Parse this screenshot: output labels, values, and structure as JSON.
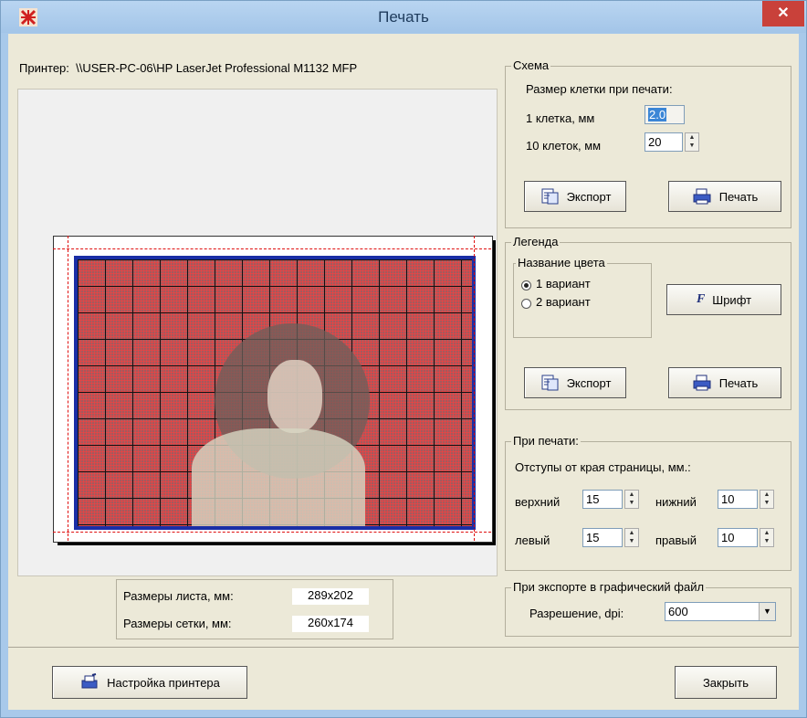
{
  "window": {
    "title": "Печать",
    "close_glyph": "✕"
  },
  "printer": {
    "label": "Принтер:",
    "name": "\\\\USER-PC-06\\HP LaserJet Professional M1132 MFP"
  },
  "schema": {
    "title": "Схема",
    "cell_size_label": "Размер клетки при печати:",
    "one_cell_label": "1 клетка, мм",
    "one_cell_value": "2.0",
    "ten_cells_label": "10 клеток, мм",
    "ten_cells_value": "20",
    "export_label": "Экспорт",
    "print_label": "Печать"
  },
  "legend": {
    "title": "Легенда",
    "color_name_title": "Название цвета",
    "variant1": "1 вариант",
    "variant2": "2 вариант",
    "selected_variant": 1,
    "font_label": "Шрифт",
    "font_icon_text": "F",
    "export_label": "Экспорт",
    "print_label": "Печать"
  },
  "print_opts": {
    "title": "При печати:",
    "margins_label": "Отступы от края страницы, мм.:",
    "top_label": "верхний",
    "top_value": "15",
    "bottom_label": "нижний",
    "bottom_value": "10",
    "left_label": "левый",
    "left_value": "15",
    "right_label": "правый",
    "right_value": "10"
  },
  "export_opts": {
    "title": "При экспорте в графический файл",
    "dpi_label": "Разрешение, dpi:",
    "dpi_value": "600"
  },
  "sizes": {
    "sheet_label": "Размеры листа, мм:",
    "sheet_value": "289x202",
    "grid_label": "Размеры сетки, мм:",
    "grid_value": "260x174"
  },
  "footer": {
    "printer_setup_label": "Настройка принтера",
    "close_label": "Закрыть"
  },
  "colors": {
    "grid_border": "#1a2ea6",
    "margin_lines": "#e01010",
    "close_red": "#c9413a"
  }
}
